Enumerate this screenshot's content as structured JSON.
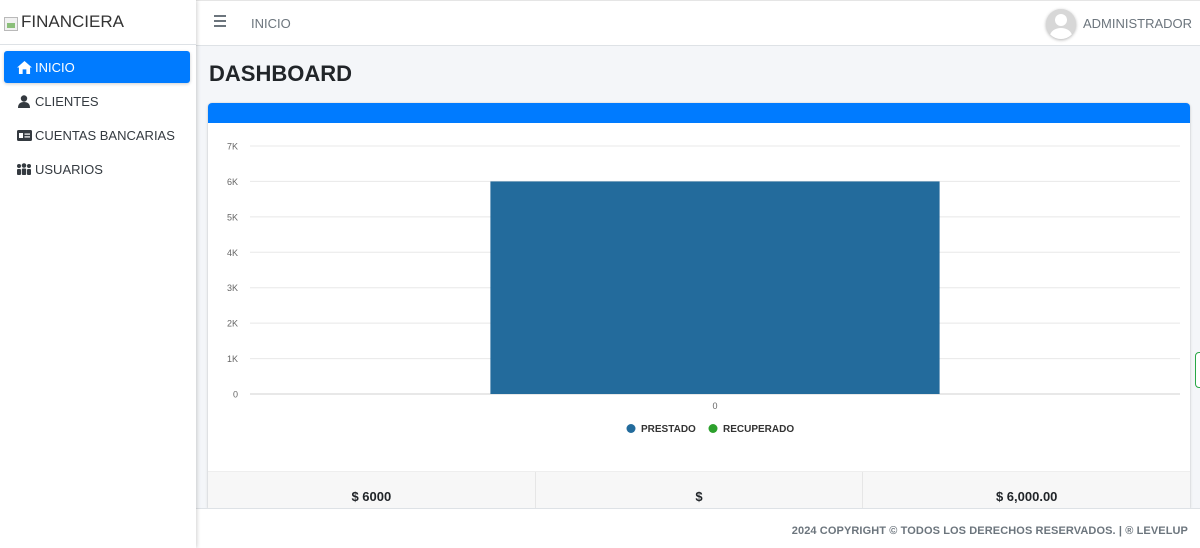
{
  "brand": {
    "name": "FINANCIERA"
  },
  "sidebar": {
    "items": [
      {
        "label": "INICIO",
        "icon": "home-icon",
        "active": true
      },
      {
        "label": "CLIENTES",
        "icon": "user-icon",
        "active": false
      },
      {
        "label": "CUENTAS BANCARIAS",
        "icon": "id-card-icon",
        "active": false
      },
      {
        "label": "USUARIOS",
        "icon": "users-icon",
        "active": false
      }
    ]
  },
  "topbar": {
    "link": "INICIO",
    "user": "ADMINISTRADOR"
  },
  "page": {
    "title": "DASHBOARD"
  },
  "colors": {
    "accent": "#007bff",
    "prestado": "#236b9c",
    "recuperado": "#2ca02c"
  },
  "chart_data": {
    "type": "bar",
    "categories": [
      "0"
    ],
    "series": [
      {
        "name": "PRESTADO",
        "values": [
          6000
        ]
      },
      {
        "name": "RECUPERADO",
        "values": [
          0
        ]
      }
    ],
    "yticks": [
      "0",
      "1K",
      "2K",
      "3K",
      "4K",
      "5K",
      "6K",
      "7K"
    ],
    "ylim": [
      0,
      7000
    ],
    "grid": true,
    "legend": "bottom"
  },
  "summary": {
    "prestado": "$ 6000",
    "recuperado": "$",
    "total": "$ 6,000.00"
  },
  "footer": {
    "copyright": "2024 COPYRIGHT © TODOS LOS DERECHOS RESERVADOS. | ® LEVELUP"
  }
}
